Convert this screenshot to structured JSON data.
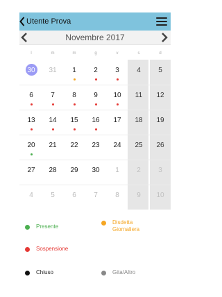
{
  "header": {
    "title": "Utente Prova",
    "menu_icon": "hamburger-menu-icon"
  },
  "calendar": {
    "month_label": "Novembre 2017",
    "weekdays": [
      "l",
      "m",
      "m",
      "g",
      "v",
      "s",
      "d"
    ],
    "today": "30",
    "weeks": [
      [
        {
          "d": "30",
          "m": true,
          "t": true
        },
        {
          "d": "31",
          "m": true
        },
        {
          "d": "1",
          "dot": "#f5a623"
        },
        {
          "d": "2",
          "dot": "#e53935"
        },
        {
          "d": "3",
          "dot": "#e53935"
        },
        {
          "d": "4"
        },
        {
          "d": "5"
        }
      ],
      [
        {
          "d": "6",
          "dot": "#e53935"
        },
        {
          "d": "7",
          "dot": "#e53935"
        },
        {
          "d": "8",
          "dot": "#e53935"
        },
        {
          "d": "9",
          "dot": "#e53935"
        },
        {
          "d": "10",
          "dot": "#e53935"
        },
        {
          "d": "11"
        },
        {
          "d": "12"
        }
      ],
      [
        {
          "d": "13",
          "dot": "#e53935"
        },
        {
          "d": "14",
          "dot": "#e53935"
        },
        {
          "d": "15",
          "dot": "#e53935"
        },
        {
          "d": "16",
          "dot": "#e53935"
        },
        {
          "d": "17"
        },
        {
          "d": "18"
        },
        {
          "d": "19"
        }
      ],
      [
        {
          "d": "20",
          "dot": "#4caf50"
        },
        {
          "d": "21"
        },
        {
          "d": "22"
        },
        {
          "d": "23"
        },
        {
          "d": "24"
        },
        {
          "d": "25"
        },
        {
          "d": "26"
        }
      ],
      [
        {
          "d": "27"
        },
        {
          "d": "28"
        },
        {
          "d": "29"
        },
        {
          "d": "30"
        },
        {
          "d": "1",
          "m": true
        },
        {
          "d": "2",
          "m": true
        },
        {
          "d": "3",
          "m": true
        }
      ],
      [
        {
          "d": "4",
          "m": true
        },
        {
          "d": "5",
          "m": true
        },
        {
          "d": "6",
          "m": true
        },
        {
          "d": "7",
          "m": true
        },
        {
          "d": "8",
          "m": true
        },
        {
          "d": "9",
          "m": true
        },
        {
          "d": "10",
          "m": true
        }
      ]
    ]
  },
  "legend": [
    {
      "label": "Presente",
      "color": "#4caf50"
    },
    {
      "label": "Disdetta Giornaliera",
      "color": "#f5a623"
    },
    {
      "label": "Sospensione",
      "color": "#e53935"
    },
    {
      "label": "Chiuso",
      "color": "#111111"
    },
    {
      "label": "Gita/Altro",
      "color": "#888888"
    }
  ],
  "colors": {
    "topbar": "#7fc3dd",
    "today": "#9b9bf5",
    "weekend_bg": "#e6e6e6"
  }
}
